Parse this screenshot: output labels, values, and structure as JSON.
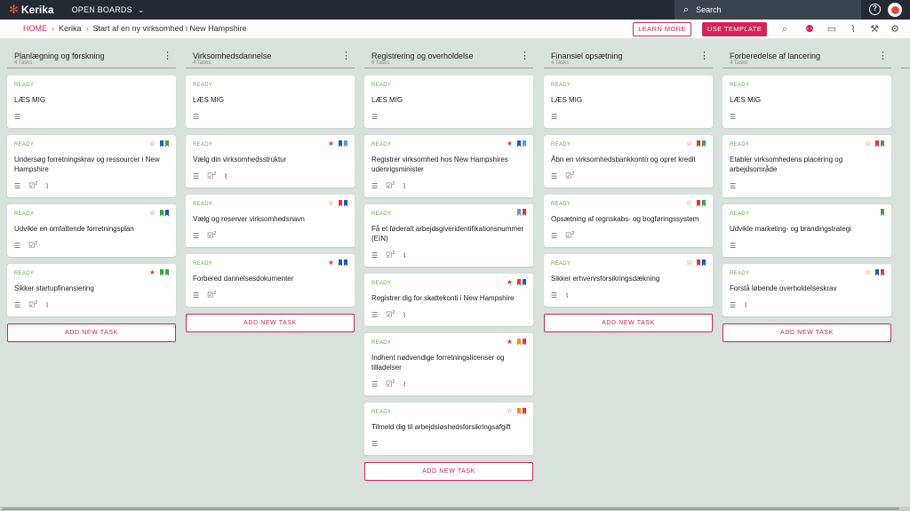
{
  "topbar": {
    "logo_text": "Kerika",
    "open_boards": "OPEN BOARDS",
    "search_placeholder": "Search",
    "help_symbol": "?"
  },
  "breadcrumb": {
    "home": "HOME",
    "account": "Kerika",
    "board": "Start af en ny virksomhed i New Hampshire"
  },
  "actions": {
    "learn_more": "LEARN MORE",
    "use_template": "USE TEMPLATE"
  },
  "icons": [
    "search-icon",
    "add-person-icon",
    "chat-icon",
    "attachment-icon",
    "wrench-icon",
    "gear-icon"
  ],
  "colors": {
    "accent": "#d2245a",
    "ready": "#6aa84f",
    "flag_blue": "#1e5bb8",
    "flag_green": "#43a047",
    "flag_red": "#e53935",
    "flag_orange": "#f28c28",
    "flag_lightblue": "#5b9be0"
  },
  "add_task_label": "ADD NEW TASK",
  "columns": [
    {
      "title": "Planlægning og forskning",
      "count": "4 Tasks",
      "cards": [
        {
          "status": "READY",
          "title": "LÆS MIG",
          "star": "",
          "flags": [],
          "icons": [
            "desc"
          ]
        },
        {
          "status": "READY",
          "title": "Undersøg forretningskrav og ressourcer i New Hampshire",
          "star": "outline",
          "flags": [
            "#1e5bb8",
            "#43a047"
          ],
          "icons": [
            "desc",
            "checklist",
            "attach"
          ],
          "checklist_count": "2"
        },
        {
          "status": "READY",
          "title": "Udvikle en omfattende forretningsplan",
          "star": "outline",
          "flags": [
            "#43a047",
            "#1e5bb8"
          ],
          "icons": [
            "desc",
            "checklist"
          ],
          "checklist_count": "2"
        },
        {
          "status": "READY",
          "title": "Sikker startupfinansiering",
          "star": "filled",
          "flags": [
            "#43a047",
            "#43a047"
          ],
          "icons": [
            "desc",
            "checklist",
            "attach"
          ],
          "checklist_count": "2"
        }
      ]
    },
    {
      "title": "Virksomhedsdannelse",
      "count": "4 Tasks",
      "cards": [
        {
          "status": "READY",
          "title": "LÆS MIG",
          "star": "",
          "flags": [],
          "icons": [
            "desc"
          ]
        },
        {
          "status": "READY",
          "title": "Vælg din virksomhedsstruktur",
          "star": "filled",
          "flags": [
            "#1e5bb8",
            "#5b9be0"
          ],
          "icons": [
            "desc",
            "checklist",
            "attach"
          ],
          "checklist_count": "2"
        },
        {
          "status": "READY",
          "title": "Vælg og reserver virksomhedsnavn",
          "star": "outline",
          "flags": [
            "#e53935",
            "#1e5bb8"
          ],
          "icons": [
            "desc",
            "checklist"
          ],
          "checklist_count": "2"
        },
        {
          "status": "READY",
          "title": "Forbered dannelsesdokumenter",
          "star": "filled",
          "flags": [
            "#1e5bb8",
            "#1e5bb8"
          ],
          "icons": [
            "desc",
            "checklist"
          ],
          "checklist_count": "2"
        }
      ]
    },
    {
      "title": "Registrering og overholdelse",
      "count": "6 Tasks",
      "cards": [
        {
          "status": "READY",
          "title": "LÆS MIG",
          "star": "",
          "flags": [],
          "icons": [
            "desc"
          ]
        },
        {
          "status": "READY",
          "title": "Registrer virksomhed hos New Hampshires udenrigsminister",
          "star": "filled",
          "flags": [
            "#1e5bb8",
            "#5b9be0"
          ],
          "icons": [
            "desc",
            "checklist",
            "attach"
          ],
          "checklist_count": "2"
        },
        {
          "status": "READY",
          "title": "Få et føderalt arbejdsgiveridentifikationsnummer (EIN)",
          "star": "",
          "flags": [
            "#5b9be0",
            "#e53935"
          ],
          "icons": [
            "desc",
            "checklist",
            "attach"
          ],
          "checklist_count": "2"
        },
        {
          "status": "READY",
          "title": "Registrer dig for skattekonti i New Hampshire",
          "star": "filled",
          "flags": [
            "#e53935",
            "#1e5bb8"
          ],
          "icons": [
            "desc",
            "checklist",
            "attach"
          ],
          "checklist_count": "2"
        },
        {
          "status": "READY",
          "title": "Indhent nødvendige forretningslicenser og tilladelser",
          "star": "filled",
          "flags": [
            "#f28c28",
            "#e53935"
          ],
          "icons": [
            "desc",
            "checklist",
            "attach"
          ],
          "checklist_count": "2"
        },
        {
          "status": "READY",
          "title": "Tilmeld dig til arbejdsløshedsforsikringsafgift",
          "star": "outline",
          "flags": [
            "#f28c28",
            "#e53935"
          ],
          "icons": [
            "desc"
          ]
        }
      ]
    },
    {
      "title": "Finansiel opsætning",
      "count": "4 Tasks",
      "cards": [
        {
          "status": "READY",
          "title": "LÆS MIG",
          "star": "",
          "flags": [],
          "icons": [
            "desc"
          ]
        },
        {
          "status": "READY",
          "title": "Åbn en virksomhedsbankkonto og opret kredit",
          "star": "outline",
          "flags": [
            "#e53935",
            "#43a047"
          ],
          "icons": [
            "desc",
            "checklist"
          ],
          "checklist_count": "2"
        },
        {
          "status": "READY",
          "title": "Opsætning af regnskabs- og bogføringssystem",
          "star": "outline",
          "flags": [
            "#e53935",
            "#43a047"
          ],
          "icons": [
            "desc",
            "checklist"
          ],
          "checklist_count": "2"
        },
        {
          "status": "READY",
          "title": "Sikker erhvervsforsikringsdækning",
          "star": "outline",
          "flags": [
            "#e53935",
            "#1e5bb8"
          ],
          "icons": [
            "desc",
            "attach"
          ]
        }
      ]
    },
    {
      "title": "Forberedelse af lancering",
      "count": "4 Tasks",
      "cards": [
        {
          "status": "READY",
          "title": "LÆS MIG",
          "star": "",
          "flags": [],
          "icons": [
            "desc"
          ]
        },
        {
          "status": "READY",
          "title": "Etabler virksomhedens placering og arbejdsområde",
          "star": "outline",
          "flags": [
            "#e53935",
            "#43a047"
          ],
          "icons": [
            "desc"
          ]
        },
        {
          "status": "READY",
          "title": "Udvikle marketing- og brandingstrategi",
          "star": "",
          "flags": [
            "#43a047"
          ],
          "icons": [
            "desc"
          ]
        },
        {
          "status": "READY",
          "title": "Forstå løbende overholdelseskrav",
          "star": "outline",
          "flags": [
            "#1e5bb8",
            "#e53935"
          ],
          "icons": [
            "desc",
            "attach"
          ]
        }
      ]
    }
  ]
}
